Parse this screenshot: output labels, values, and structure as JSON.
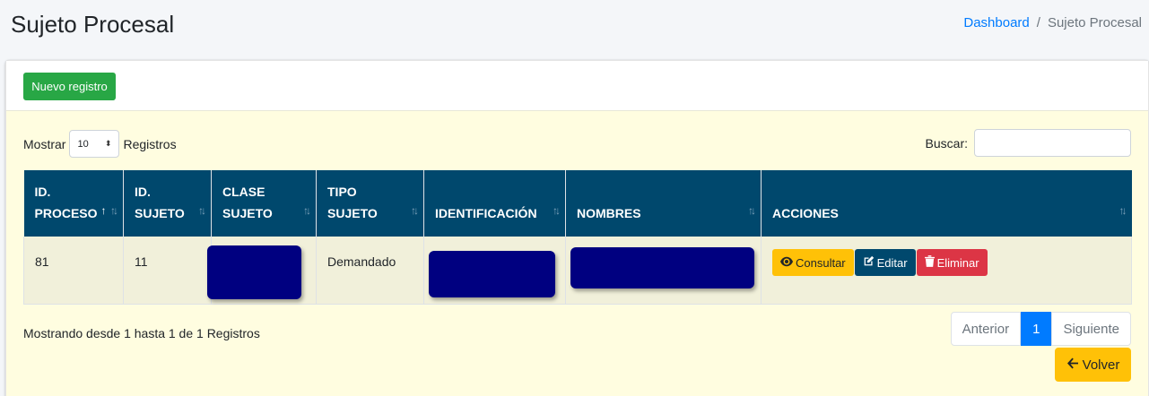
{
  "page": {
    "title": "Sujeto Procesal",
    "breadcrumb": {
      "home": "Dashboard",
      "separator": "/",
      "current": "Sujeto Procesal"
    }
  },
  "toolbar": {
    "new_label": "Nuevo registro"
  },
  "controls": {
    "show_label": "Mostrar",
    "page_size": "10",
    "records_label": "Registros",
    "search_label": "Buscar:",
    "search_value": ""
  },
  "table": {
    "headers": [
      {
        "line1": "ID.",
        "line2": "PROCESO"
      },
      {
        "line1": "ID.",
        "line2": "SUJETO"
      },
      {
        "line1": "CLASE",
        "line2": "SUJETO"
      },
      {
        "line1": "TIPO",
        "line2": "SUJETO"
      },
      {
        "line1": "",
        "line2": "IDENTIFICACIÓN"
      },
      {
        "line1": "",
        "line2": "NOMBRES"
      },
      {
        "line1": "",
        "line2": "ACCIONES"
      }
    ],
    "rows": [
      {
        "id_proceso": "81",
        "id_sujeto": "11",
        "clase_sujeto": "",
        "tipo_sujeto": "Demandado",
        "identificacion": "",
        "nombres": ""
      }
    ],
    "actions": {
      "view": "Consultar",
      "edit": "Editar",
      "delete": "Eliminar"
    }
  },
  "footer": {
    "info": "Mostrando desde 1 hasta 1 de 1 Registros",
    "pagination": {
      "prev": "Anterior",
      "current": "1",
      "next": "Siguiente"
    },
    "back_label": "Volver"
  },
  "colors": {
    "header_bg": "#00486d",
    "success": "#28a745",
    "warning": "#ffc107",
    "danger": "#dc3545",
    "primary": "#007bff",
    "redaction": "#000080"
  }
}
